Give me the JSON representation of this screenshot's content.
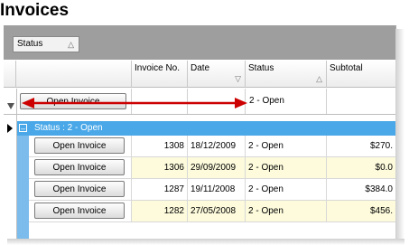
{
  "page_title": "Invoices",
  "group_chip": {
    "label": "Status",
    "sort_icon": "triangle-up-icon"
  },
  "columns": [
    {
      "label": "",
      "icon": ""
    },
    {
      "label": "Invoice No.",
      "icon": ""
    },
    {
      "label": "Date",
      "icon": "filter-funnel-icon"
    },
    {
      "label": "Status",
      "icon": "triangle-up-icon"
    },
    {
      "label": "Subtotal",
      "icon": ""
    }
  ],
  "filter_row": {
    "button_label": "Open Invoice",
    "status_value": "2 - Open"
  },
  "group_header": {
    "label": "Status : 2 - Open"
  },
  "rows": [
    {
      "button": "Open Invoice",
      "invoice_no": "1308",
      "date": "18/12/2009",
      "status": "2 - Open",
      "subtotal": "$270.",
      "highlight": false
    },
    {
      "button": "Open Invoice",
      "invoice_no": "1306",
      "date": "29/09/2009",
      "status": "2 - Open",
      "subtotal": "$0.0",
      "highlight": true
    },
    {
      "button": "Open Invoice",
      "invoice_no": "1287",
      "date": "19/11/2008",
      "status": "2 - Open",
      "subtotal": "$384.0",
      "highlight": false
    },
    {
      "button": "Open Invoice",
      "invoice_no": "1282",
      "date": "27/05/2008",
      "status": "2 - Open",
      "subtotal": "$456.",
      "highlight": true
    }
  ],
  "colors": {
    "group_header": "#4aa8e8",
    "highlight_row": "#fdfbdc",
    "arrow": "#cc0000",
    "group_bar": "#9e9e9e"
  }
}
